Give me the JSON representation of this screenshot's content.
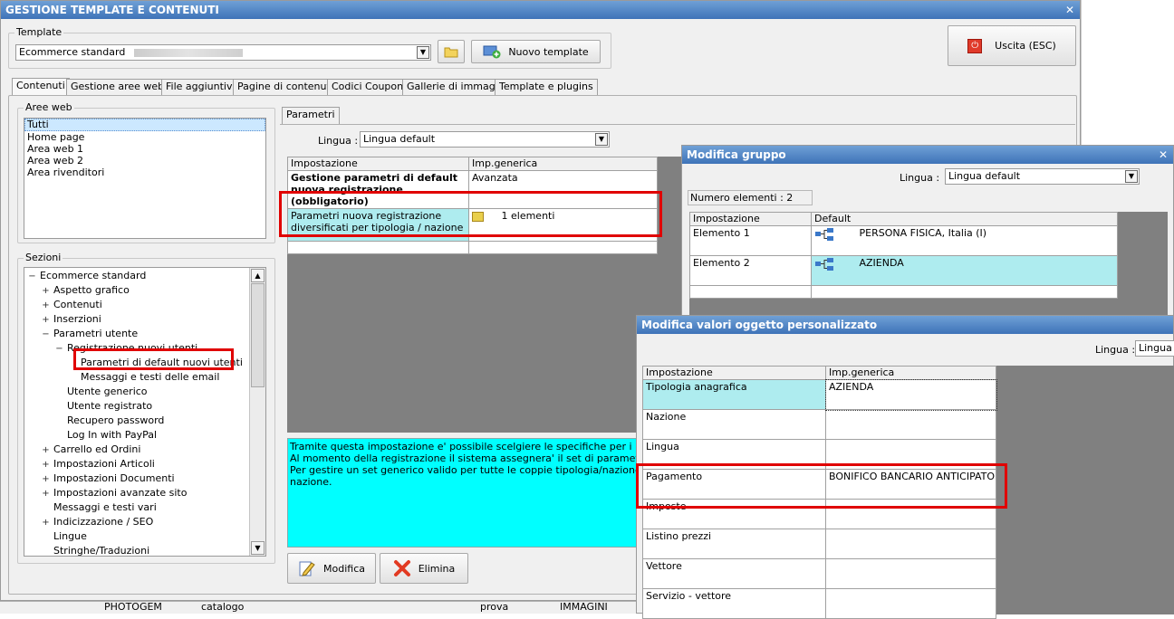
{
  "main": {
    "title": "GESTIONE TEMPLATE E CONTENUTI",
    "template_label": "Template",
    "template_value": "Ecommerce standard",
    "new_template_label": "Nuovo template",
    "exit_label": "Uscita (ESC)",
    "tabs": [
      "Contenuti",
      "Gestione aree web",
      "File aggiuntivi",
      "Pagine di contenuti",
      "Codici Coupon",
      "Gallerie di immagini",
      "Template e plugins"
    ],
    "aree_web_label": "Aree web",
    "aree_web": [
      "Tutti",
      "Home page",
      "Area web 1",
      "Area web 2",
      "Area rivenditori"
    ],
    "sezioni_label": "Sezioni",
    "tree": [
      {
        "t": "Ecommerce standard",
        "lvl": 0,
        "pm": "−"
      },
      {
        "t": "Aspetto grafico",
        "lvl": 1,
        "pm": "+"
      },
      {
        "t": "Contenuti",
        "lvl": 1,
        "pm": "+"
      },
      {
        "t": "Inserzioni",
        "lvl": 1,
        "pm": "+"
      },
      {
        "t": "Parametri utente",
        "lvl": 1,
        "pm": "−"
      },
      {
        "t": "Registrazione nuovi utenti",
        "lvl": 2,
        "pm": "−"
      },
      {
        "t": "Parametri di default nuovi utenti",
        "lvl": 3,
        "pm": ""
      },
      {
        "t": "Messaggi e testi delle email",
        "lvl": 3,
        "pm": ""
      },
      {
        "t": "Utente generico",
        "lvl": 2,
        "pm": ""
      },
      {
        "t": "Utente registrato",
        "lvl": 2,
        "pm": ""
      },
      {
        "t": "Recupero password",
        "lvl": 2,
        "pm": ""
      },
      {
        "t": "Log In with PayPal",
        "lvl": 2,
        "pm": ""
      },
      {
        "t": "Carrello ed Ordini",
        "lvl": 1,
        "pm": "+"
      },
      {
        "t": "Impostazioni Articoli",
        "lvl": 1,
        "pm": "+"
      },
      {
        "t": "Impostazioni Documenti",
        "lvl": 1,
        "pm": "+"
      },
      {
        "t": "Impostazioni avanzate sito",
        "lvl": 1,
        "pm": "+"
      },
      {
        "t": "Messaggi e testi vari",
        "lvl": 1,
        "pm": ""
      },
      {
        "t": "Indicizzazione / SEO",
        "lvl": 1,
        "pm": "+"
      },
      {
        "t": "Lingue",
        "lvl": 1,
        "pm": ""
      },
      {
        "t": "Stringhe/Traduzioni",
        "lvl": 1,
        "pm": ""
      }
    ],
    "parametri_tab": "Parametri",
    "lingua_label": "Lingua :",
    "lingua_value": "Lingua default",
    "grid_headers": [
      "Impostazione",
      "Imp.generica"
    ],
    "row1_name": "Gestione parametri di default nuova registrazione (obbligatorio)",
    "row1_value": "Avanzata",
    "row2_name": "Parametri nuova registrazione diversificati per tipologia / nazione",
    "row2_value": "1 elementi",
    "description": "Tramite questa impostazione e' possibile scelgiere le specifiche per i nuovi utenti\nAl momento della registrazione il sistema assegnera' il set di parametri della prima\nPer gestire un set generico valido per tutte le coppie tipologia/nazione (non espl\nnazione.",
    "modifica_label": "Modifica",
    "elimina_label": "Elimina",
    "status": [
      "PHOTOGEM",
      "catalogo",
      "prova",
      "IMMAGINI"
    ]
  },
  "gruppo": {
    "title": "Modifica gruppo",
    "lingua_label": "Lingua :",
    "lingua_value": "Lingua default",
    "count_label": "Numero elementi : 2",
    "headers": [
      "Impostazione",
      "Default"
    ],
    "rows": [
      {
        "name": "Elemento 1",
        "value": "PERSONA FISICA, Italia (I)"
      },
      {
        "name": "Elemento 2",
        "value": "AZIENDA"
      }
    ]
  },
  "valori": {
    "title": "Modifica valori oggetto personalizzato",
    "lingua_label": "Lingua :",
    "lingua_value": "Lingua d",
    "headers": [
      "Impostazione",
      "Imp.generica"
    ],
    "rows": [
      {
        "name": "Tipologia anagrafica",
        "value": "AZIENDA"
      },
      {
        "name": "Nazione",
        "value": ""
      },
      {
        "name": "Lingua",
        "value": ""
      },
      {
        "name": "Pagamento",
        "value": "BONIFICO BANCARIO ANTICIPATO"
      },
      {
        "name": "Imposte",
        "value": ""
      },
      {
        "name": "Listino prezzi",
        "value": ""
      },
      {
        "name": "Vettore",
        "value": ""
      },
      {
        "name": "Servizio - vettore",
        "value": ""
      }
    ]
  },
  "colors": {
    "title_bar": "#3e73b8",
    "highlight": "#e00000",
    "cyan_row": "#aeecef",
    "description_bg": "#00ffff"
  }
}
